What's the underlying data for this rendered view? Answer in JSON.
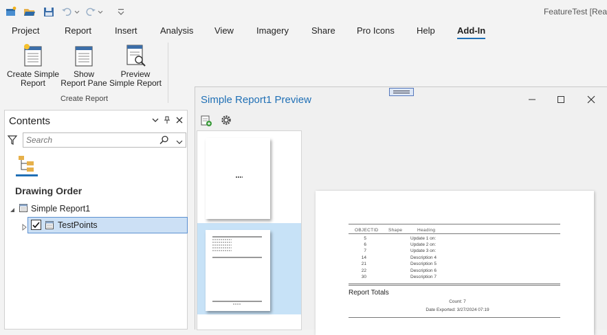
{
  "app": {
    "title": "FeatureTest [Rea"
  },
  "quick_access": [
    {
      "name": "new-project-icon"
    },
    {
      "name": "open-project-icon"
    },
    {
      "name": "save-project-icon"
    },
    {
      "name": "undo-icon"
    },
    {
      "name": "redo-icon"
    },
    {
      "name": "customize-toolbar-icon"
    }
  ],
  "ribbon": {
    "tabs": [
      {
        "label": "Project"
      },
      {
        "label": "Report"
      },
      {
        "label": "Insert"
      },
      {
        "label": "Analysis"
      },
      {
        "label": "View"
      },
      {
        "label": "Imagery"
      },
      {
        "label": "Share"
      },
      {
        "label": "Pro Icons"
      },
      {
        "label": "Help"
      },
      {
        "label": "Add-In"
      }
    ],
    "active_tab": "Add-In",
    "buttons": [
      {
        "line1": "Create Simple",
        "line2": "Report"
      },
      {
        "line1": "Show",
        "line2": "Report Pane"
      },
      {
        "line1": "Preview",
        "line2": "Simple Report"
      }
    ],
    "group_label": "Create Report"
  },
  "contents": {
    "title": "Contents",
    "search_placeholder": "Search",
    "section_title": "Drawing Order",
    "report_item": "Simple Report1",
    "layer_item": "TestPoints",
    "layer_checked": true
  },
  "preview": {
    "title": "Simple Report1 Preview",
    "report": {
      "headers": [
        "OBJECTID",
        "Shape",
        "Heading"
      ],
      "rows": [
        {
          "objectid": "5",
          "heading": "Update 1 on:"
        },
        {
          "objectid": "6",
          "heading": "Update 2 on:"
        },
        {
          "objectid": "7",
          "heading": "Update 3 on:"
        },
        {
          "objectid": "14",
          "heading": "Description 4"
        },
        {
          "objectid": "21",
          "heading": "Description 5"
        },
        {
          "objectid": "22",
          "heading": "Description 6"
        },
        {
          "objectid": "30",
          "heading": "Description 7"
        }
      ],
      "totals_label": "Report Totals",
      "count_text": "Count: 7",
      "date_text": "Date Exported: 3/27/2024 07:19"
    }
  },
  "colors": {
    "accent": "#1f6fb5",
    "selection": "#cce0f5",
    "thumb_selection": "#c7e2f7"
  }
}
